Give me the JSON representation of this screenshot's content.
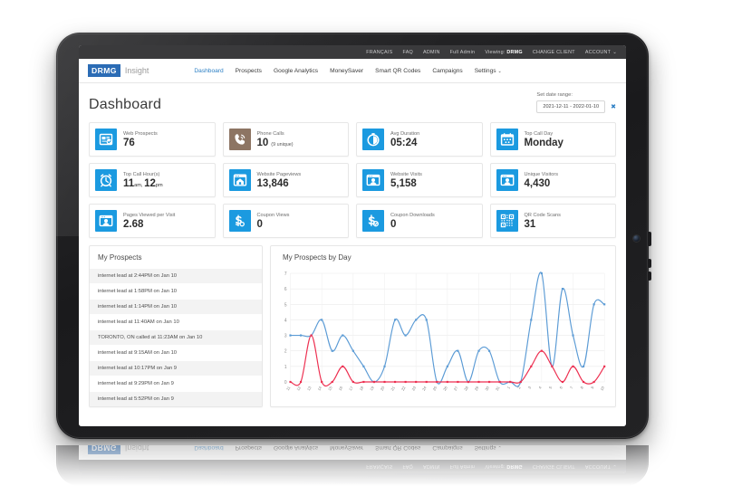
{
  "utility_bar": {
    "items": [
      "FRANÇAIS",
      "FAQ",
      "ADMIN",
      "Full Admin"
    ],
    "viewing_label": "Viewing:",
    "viewing_client": "DRMG",
    "change_client": "CHANGE CLIENT",
    "account": "ACCOUNT",
    "caret": "⌄"
  },
  "brand": {
    "mark": "DRMG",
    "sub": "Insight"
  },
  "nav": {
    "items": [
      {
        "label": "Dashboard",
        "active": true
      },
      {
        "label": "Prospects",
        "active": false
      },
      {
        "label": "Google Analytics",
        "active": false
      },
      {
        "label": "MoneySaver",
        "active": false
      },
      {
        "label": "Smart QR Codes",
        "active": false
      },
      {
        "label": "Campaigns",
        "active": false
      },
      {
        "label": "Settings",
        "active": false
      }
    ],
    "settings_caret": "⌄"
  },
  "page": {
    "title": "Dashboard",
    "date_range_label": "Set date range:",
    "date_range_value": "2021-12-11 - 2022-01-10",
    "date_range_clear": "✖"
  },
  "kpis": [
    {
      "label": "Web Prospects",
      "value": "76",
      "sub": "",
      "icon": "web-prospects-icon",
      "color": "#1b9ae0"
    },
    {
      "label": "Phone Calls",
      "value": "10",
      "sub": "(9 unique)",
      "icon": "phone-calls-icon",
      "color": "#8d7563"
    },
    {
      "label": "Avg Duration",
      "value": "05:24",
      "sub": "",
      "icon": "avg-duration-icon",
      "color": "#1b9ae0"
    },
    {
      "label": "Top Call Day",
      "value": "Monday",
      "sub": "",
      "icon": "top-call-day-icon",
      "color": "#1b9ae0"
    },
    {
      "label": "Top Call Hour(s)",
      "value": "11",
      "sub": "",
      "icon": "top-call-hours-icon",
      "color": "#1b9ae0",
      "value_parts": [
        {
          "num": "11",
          "unit": "am"
        },
        {
          "num": "12",
          "unit": "pm"
        }
      ]
    },
    {
      "label": "Website Pageviews",
      "value": "13,846",
      "sub": "",
      "icon": "website-pageviews-icon",
      "color": "#1b9ae0"
    },
    {
      "label": "Website Visits",
      "value": "5,158",
      "sub": "",
      "icon": "website-visits-icon",
      "color": "#1b9ae0"
    },
    {
      "label": "Unique Visitors",
      "value": "4,430",
      "sub": "",
      "icon": "unique-visitors-icon",
      "color": "#1b9ae0"
    },
    {
      "label": "Pages Viewed per Visit",
      "value": "2.68",
      "sub": "",
      "icon": "pages-per-visit-icon",
      "color": "#1b9ae0"
    },
    {
      "label": "Coupon Views",
      "value": "0",
      "sub": "",
      "icon": "coupon-views-icon",
      "color": "#1b9ae0"
    },
    {
      "label": "Coupon Downloads",
      "value": "0",
      "sub": "",
      "icon": "coupon-downloads-icon",
      "color": "#1b9ae0"
    },
    {
      "label": "QR Code Scans",
      "value": "31",
      "sub": "",
      "icon": "qr-code-scans-icon",
      "color": "#1b9ae0"
    }
  ],
  "prospects_panel": {
    "title": "My Prospects",
    "items": [
      "internet lead at 2:44PM on Jan 10",
      "internet lead at 1:58PM on Jan 10",
      "internet lead at 1:14PM on Jan 10",
      "internet lead at 11:40AM on Jan 10",
      "TORONTO, ON called at 11:23AM on Jan 10",
      "internet lead at 9:15AM on Jan 10",
      "internet lead at 10:17PM on Jan 9",
      "internet lead at 9:29PM on Jan 9",
      "internet lead at 5:52PM on Jan 9"
    ]
  },
  "chart_panel": {
    "title": "My Prospects by Day"
  },
  "chart_data": {
    "type": "line",
    "title": "My Prospects by Day",
    "xlabel": "",
    "ylabel": "",
    "ylim": [
      0,
      7
    ],
    "yticks": [
      0,
      1,
      2,
      3,
      4,
      5,
      6,
      7
    ],
    "grid": true,
    "legend": "none",
    "categories": [
      "11",
      "12",
      "13",
      "14",
      "15",
      "16",
      "17",
      "18",
      "19",
      "20",
      "21",
      "22",
      "23",
      "24",
      "25",
      "26",
      "27",
      "28",
      "29",
      "30",
      "31",
      "1",
      "2",
      "3",
      "4",
      "5",
      "6",
      "7",
      "8",
      "9",
      "10"
    ],
    "series": [
      {
        "name": "Web Prospects",
        "color": "#5b9bd5",
        "values": [
          3,
          3,
          3,
          4,
          2,
          3,
          2,
          1,
          0,
          1,
          4,
          3,
          4,
          4,
          0,
          1,
          2,
          0,
          2,
          2,
          0,
          0,
          0,
          4,
          7,
          1,
          6,
          3,
          1,
          5,
          5
        ]
      },
      {
        "name": "Phone Calls",
        "color": "#ed2f50",
        "values": [
          0,
          0,
          3,
          0,
          0,
          1,
          0,
          0,
          0,
          0,
          0,
          0,
          0,
          0,
          0,
          0,
          0,
          0,
          0,
          0,
          0,
          0,
          0,
          1,
          2,
          1,
          0,
          1,
          0,
          0,
          1
        ]
      }
    ]
  }
}
